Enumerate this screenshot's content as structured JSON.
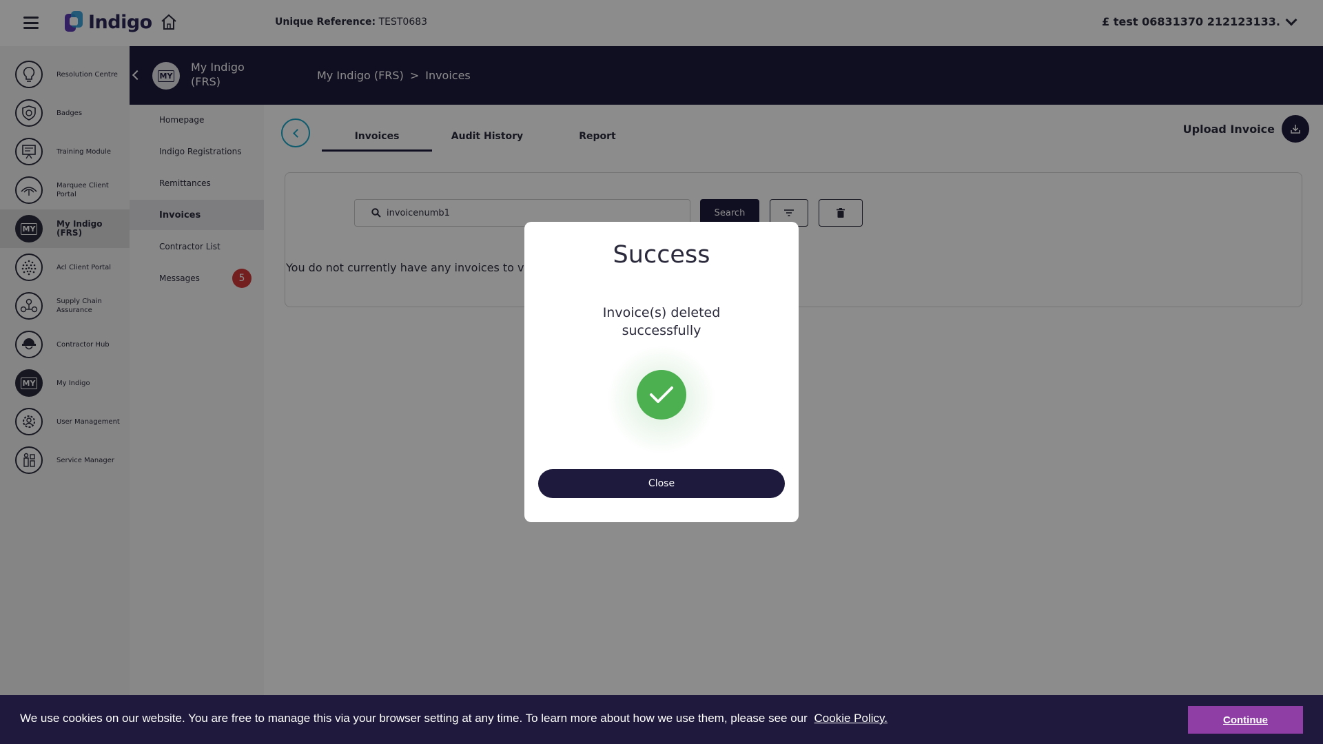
{
  "app": {
    "logo_text": "Indigo",
    "unique_reference_label": "Unique Reference:",
    "unique_reference_value": "TEST0683",
    "account_name": "£ test 06831370 212123133."
  },
  "sidebar": {
    "items": [
      {
        "label": "Resolution Centre",
        "icon": "lightbulb-icon"
      },
      {
        "label": "Badges",
        "icon": "shield-badge-icon"
      },
      {
        "label": "Training Module",
        "icon": "training-board-icon"
      },
      {
        "label": "Marquee Client Portal",
        "icon": "marquee-icon"
      },
      {
        "label": "My Indigo (FRS)",
        "icon": "my-folder-icon",
        "active": true
      },
      {
        "label": "Acl Client Portal",
        "icon": "dots-globe-icon"
      },
      {
        "label": "Supply Chain Assurance",
        "icon": "network-icon"
      },
      {
        "label": "Contractor Hub",
        "icon": "hard-hat-icon"
      },
      {
        "label": "My Indigo",
        "icon": "my-icon"
      },
      {
        "label": "User Management",
        "icon": "user-gear-icon"
      },
      {
        "label": "Service Manager",
        "icon": "service-manager-icon"
      }
    ],
    "my_badge_text": "MY"
  },
  "subheader": {
    "title": "My Indigo (FRS)",
    "avatar_text": "MY",
    "breadcrumb": [
      "My Indigo (FRS)",
      ">",
      "Invoices"
    ]
  },
  "subnav": {
    "items": [
      {
        "label": "Homepage"
      },
      {
        "label": "Indigo Registrations"
      },
      {
        "label": "Remittances"
      },
      {
        "label": "Invoices",
        "active": true
      },
      {
        "label": "Contractor List"
      },
      {
        "label": "Messages",
        "badge": "5"
      }
    ]
  },
  "tabs": [
    "Invoices",
    "Audit History",
    "Report"
  ],
  "upload_label": "Upload Invoice",
  "search": {
    "value": "invoicenumb1",
    "button_label": "Search"
  },
  "empty_message": "You do not currently have any invoices to view.",
  "modal": {
    "title": "Success",
    "message": "Invoice(s) deleted successfully",
    "close_label": "Close"
  },
  "cookie": {
    "text": "We use cookies on our website. You are free to manage this via your browser setting at any time. To learn more about how we use them, please see our",
    "link_text": "Cookie Policy.",
    "button_label": "Continue"
  },
  "colors": {
    "brand_dark": "#1e1a3d",
    "success_green": "#4caf50",
    "accent_teal": "#1aa7c9",
    "badge_red": "#d43a3a",
    "cookie_button": "#8e3ea5"
  }
}
